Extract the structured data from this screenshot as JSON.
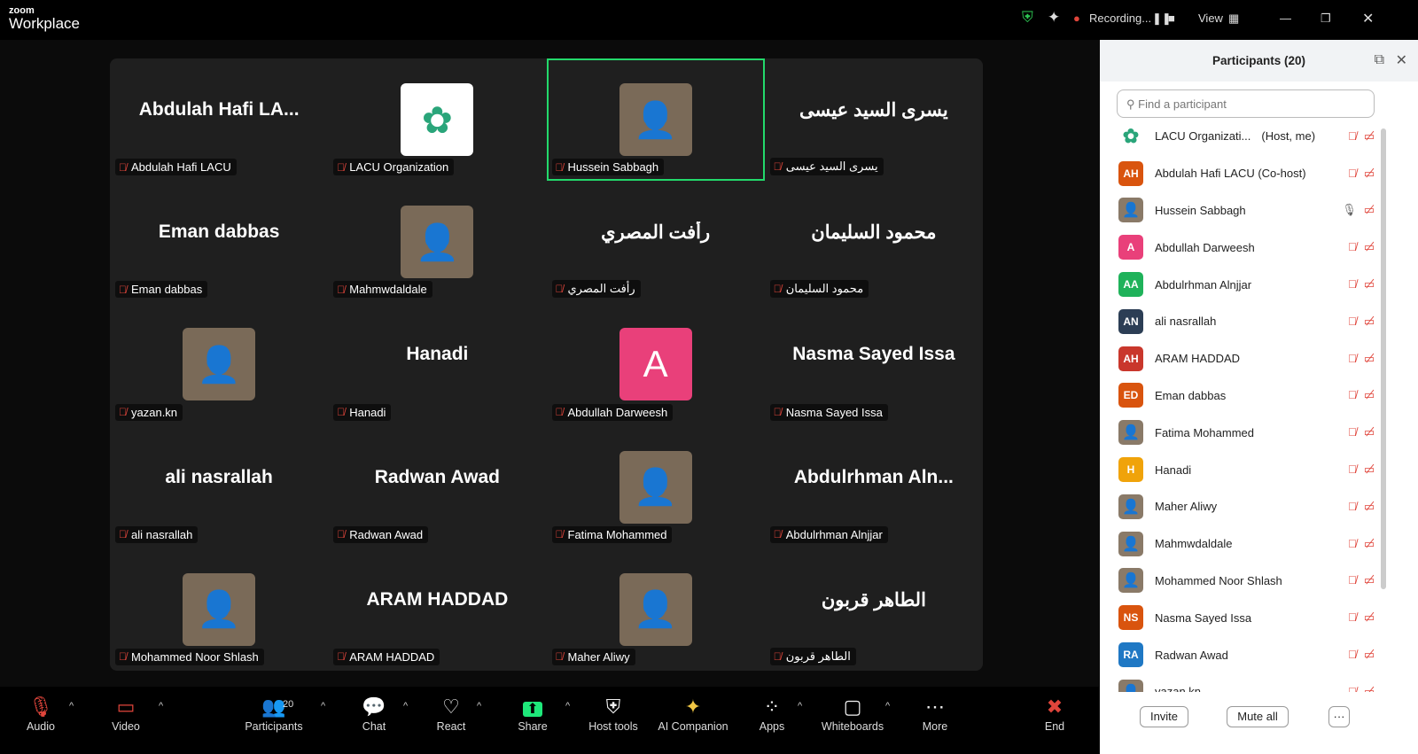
{
  "app": {
    "brand_small": "zoom",
    "brand": "Workplace",
    "recording": "Recording...",
    "view": "View"
  },
  "colors": {
    "accent_green": "#23d96b",
    "mute_red": "#e0453b",
    "share_green": "#1ee87a"
  },
  "tiles": [
    {
      "big": "Abdulah Hafi LA...",
      "name": "Abdulah Hafi LACU",
      "type": "text"
    },
    {
      "name": "LACU Organization",
      "type": "logo"
    },
    {
      "name": "Hussein Sabbagh",
      "type": "photo",
      "active": true
    },
    {
      "big": "يسرى السيد عيسى",
      "name": "يسرى السيد عيسى",
      "type": "text"
    },
    {
      "big": "Eman dabbas",
      "name": "Eman dabbas",
      "type": "text"
    },
    {
      "name": "Mahmwdaldale",
      "type": "photo"
    },
    {
      "big": "رأفت المصري",
      "name": "رأفت المصري",
      "type": "text"
    },
    {
      "big": "محمود السليمان",
      "name": "محمود السليمان",
      "type": "text"
    },
    {
      "name": "yazan.kn",
      "type": "photo"
    },
    {
      "big": "Hanadi",
      "name": "Hanadi",
      "type": "text"
    },
    {
      "name": "Abdullah Darweesh",
      "type": "letter",
      "letter": "A",
      "color": "#e9407a"
    },
    {
      "big": "Nasma Sayed Issa",
      "name": "Nasma Sayed Issa",
      "type": "text"
    },
    {
      "big": "ali nasrallah",
      "name": "ali nasrallah",
      "type": "text"
    },
    {
      "big": "Radwan Awad",
      "name": "Radwan Awad",
      "type": "text"
    },
    {
      "name": "Fatima Mohammed",
      "type": "photo"
    },
    {
      "big": "Abdulrhman  Aln...",
      "name": "Abdulrhman Alnjjar",
      "type": "text"
    },
    {
      "name": "Mohammed Noor Shlash",
      "type": "photo"
    },
    {
      "big": "ARAM HADDAD",
      "name": "ARAM HADDAD",
      "type": "text"
    },
    {
      "name": "Maher Aliwy",
      "type": "photo"
    },
    {
      "big": "الطاهر قربون",
      "name": "الطاهر قربون",
      "type": "text"
    }
  ],
  "toolbar": [
    {
      "label": "Audio",
      "icon": "mic-off-icon",
      "glyph": "🎙"
    },
    {
      "label": "Video",
      "icon": "video-off-icon",
      "glyph": "▭"
    },
    {
      "label": "Participants",
      "icon": "participants-icon",
      "glyph": "👥",
      "count": "20"
    },
    {
      "label": "Chat",
      "icon": "chat-icon",
      "glyph": "💬"
    },
    {
      "label": "React",
      "icon": "heart-icon",
      "glyph": "♡"
    },
    {
      "label": "Share",
      "icon": "share-icon",
      "glyph": "⬆"
    },
    {
      "label": "Host tools",
      "icon": "shield-icon",
      "glyph": "⛨"
    },
    {
      "label": "AI Companion",
      "icon": "sparkle-icon",
      "glyph": "✦"
    },
    {
      "label": "Apps",
      "icon": "apps-icon",
      "glyph": "⁘"
    },
    {
      "label": "Whiteboards",
      "icon": "whiteboard-icon",
      "glyph": "▢"
    },
    {
      "label": "More",
      "icon": "more-icon",
      "glyph": "⋯"
    },
    {
      "label": "End",
      "icon": "end-icon",
      "glyph": "✖"
    }
  ],
  "panel": {
    "title": "Participants (20)",
    "search_placeholder": "Find a participant",
    "invite": "Invite",
    "mute_all": "Mute all",
    "more": "···",
    "participants": [
      {
        "name": "LACU Organizati...",
        "role": "(Host, me)",
        "av": "logo"
      },
      {
        "name": "Abdulah Hafi LACU (Co-host)",
        "av": "AH",
        "color": "#d9540e"
      },
      {
        "name": "Hussein Sabbagh",
        "av": "photo",
        "mic_on": true
      },
      {
        "name": "Abdullah Darweesh",
        "av": "A",
        "color": "#e9407a"
      },
      {
        "name": "Abdulrhman Alnjjar",
        "av": "AA",
        "color": "#1fb25a"
      },
      {
        "name": "ali nasrallah",
        "av": "AN",
        "color": "#2c3e55"
      },
      {
        "name": "ARAM HADDAD",
        "av": "AH",
        "color": "#c9372c"
      },
      {
        "name": "Eman dabbas",
        "av": "ED",
        "color": "#d9540e"
      },
      {
        "name": "Fatima Mohammed",
        "av": "photo"
      },
      {
        "name": "Hanadi",
        "av": "H",
        "color": "#f0a30a"
      },
      {
        "name": "Maher Aliwy",
        "av": "photo"
      },
      {
        "name": "Mahmwdaldale",
        "av": "photo"
      },
      {
        "name": "Mohammed Noor Shlash",
        "av": "photo"
      },
      {
        "name": "Nasma Sayed Issa",
        "av": "NS",
        "color": "#d9540e"
      },
      {
        "name": "Radwan Awad",
        "av": "RA",
        "color": "#1f78c4"
      },
      {
        "name": "yazan.kn",
        "av": "photo"
      }
    ]
  }
}
